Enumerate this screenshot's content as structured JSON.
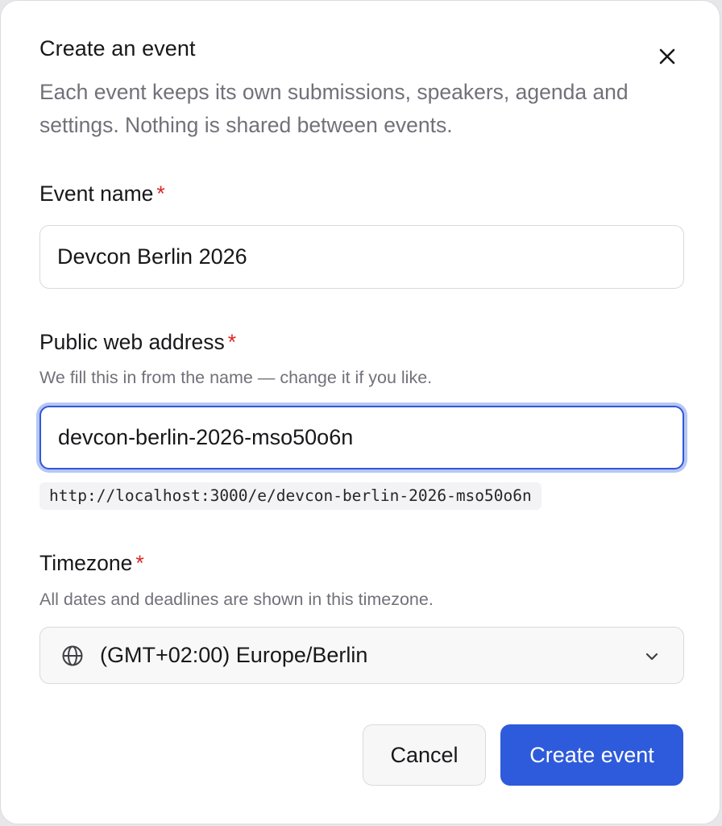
{
  "dialog": {
    "title": "Create an event",
    "description": "Each event keeps its own submissions, speakers, agenda and settings. Nothing is shared between events.",
    "close_icon": "close-icon"
  },
  "fields": {
    "event_name": {
      "label": "Event name",
      "required_mark": "*",
      "value": "Devcon Berlin 2026"
    },
    "web_address": {
      "label": "Public web address",
      "required_mark": "*",
      "hint": "We fill this in from the name — change it if you like.",
      "value": "devcon-berlin-2026-mso50o6n",
      "url_preview": "http://localhost:3000/e/devcon-berlin-2026-mso50o6n"
    },
    "timezone": {
      "label": "Timezone",
      "required_mark": "*",
      "hint": "All dates and deadlines are shown in this timezone.",
      "selected": "(GMT+02:00) Europe/Berlin",
      "icon": "globe-icon"
    }
  },
  "actions": {
    "cancel_label": "Cancel",
    "create_label": "Create event"
  },
  "colors": {
    "primary": "#2e5bdb",
    "required": "#dc2626",
    "focus_ring": "#b6c6f5",
    "muted_text": "#71717a"
  }
}
